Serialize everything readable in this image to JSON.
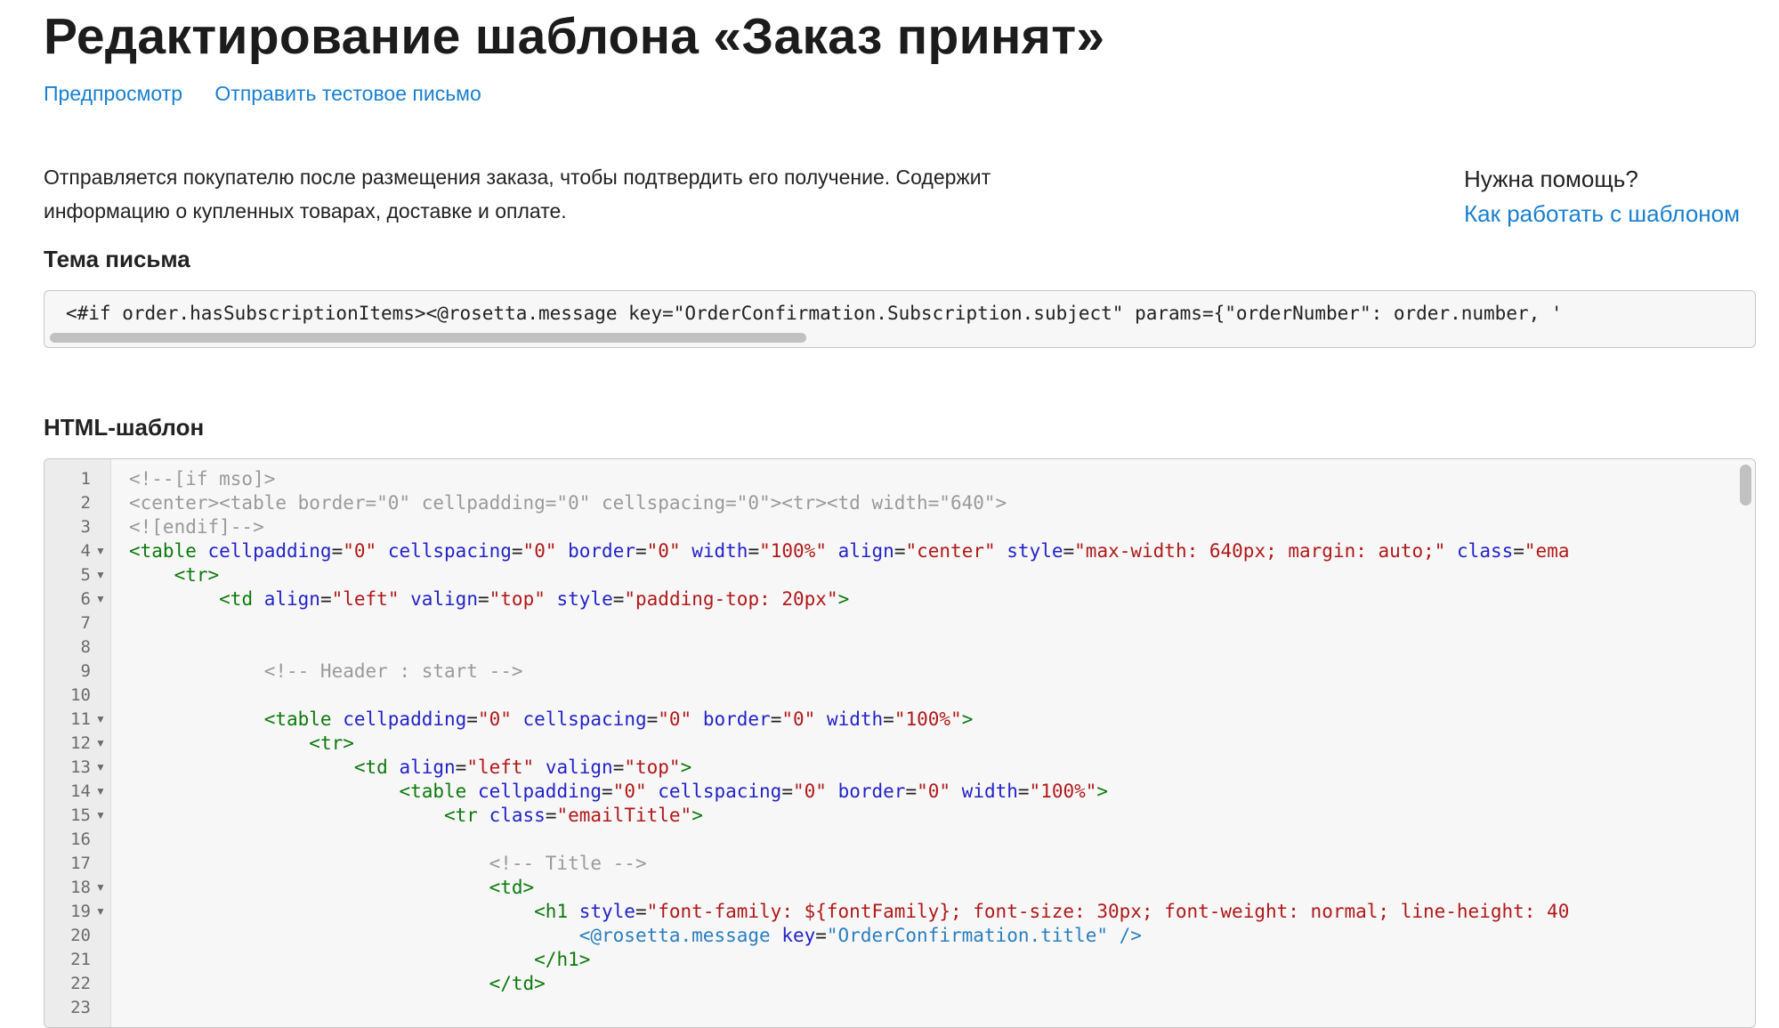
{
  "page": {
    "title": "Редактирование шаблона «Заказ принят»",
    "actions": [
      {
        "label": "Предпросмотр"
      },
      {
        "label": "Отправить тестовое письмо"
      }
    ],
    "description": "Отправляется покупателю после размещения заказа, чтобы подтвердить его получение. Содержит информацию о купленных товарах, доставке и оплате."
  },
  "help": {
    "question": "Нужна помощь?",
    "link": "Как работать с шаблоном"
  },
  "subject": {
    "label": "Тема письма",
    "value": "<#if order.hasSubscriptionItems><@rosetta.message key=\"OrderConfirmation.Subscription.subject\" params={\"orderNumber\": order.number, '"
  },
  "html_template": {
    "label": "HTML-шаблон",
    "lines": [
      {
        "num": "1",
        "fold": false,
        "indent": 0,
        "tokens": [
          {
            "t": "com",
            "v": "<!--[if mso]>"
          }
        ]
      },
      {
        "num": "2",
        "fold": false,
        "indent": 0,
        "tokens": [
          {
            "t": "com",
            "v": "<center><table border=\"0\" cellpadding=\"0\" cellspacing=\"0\"><tr><td width=\"640\">"
          }
        ]
      },
      {
        "num": "3",
        "fold": false,
        "indent": 0,
        "tokens": [
          {
            "t": "com",
            "v": "<![endif]-->"
          }
        ]
      },
      {
        "num": "4",
        "fold": true,
        "indent": 0,
        "tokens": [
          {
            "t": "tag",
            "v": "<table"
          },
          {
            "t": "attr",
            "v": " cellpadding"
          },
          {
            "t": "txt",
            "v": "="
          },
          {
            "t": "val",
            "v": "\"0\""
          },
          {
            "t": "attr",
            "v": " cellspacing"
          },
          {
            "t": "txt",
            "v": "="
          },
          {
            "t": "val",
            "v": "\"0\""
          },
          {
            "t": "attr",
            "v": " border"
          },
          {
            "t": "txt",
            "v": "="
          },
          {
            "t": "val",
            "v": "\"0\""
          },
          {
            "t": "attr",
            "v": " width"
          },
          {
            "t": "txt",
            "v": "="
          },
          {
            "t": "val",
            "v": "\"100%\""
          },
          {
            "t": "attr",
            "v": " align"
          },
          {
            "t": "txt",
            "v": "="
          },
          {
            "t": "val",
            "v": "\"center\""
          },
          {
            "t": "attr",
            "v": " style"
          },
          {
            "t": "txt",
            "v": "="
          },
          {
            "t": "val",
            "v": "\"max-width: 640px; margin: auto;\""
          },
          {
            "t": "attr",
            "v": " class"
          },
          {
            "t": "txt",
            "v": "="
          },
          {
            "t": "val",
            "v": "\"ema"
          }
        ]
      },
      {
        "num": "5",
        "fold": true,
        "indent": 4,
        "tokens": [
          {
            "t": "tag",
            "v": "<tr>"
          }
        ]
      },
      {
        "num": "6",
        "fold": true,
        "indent": 8,
        "tokens": [
          {
            "t": "tag",
            "v": "<td"
          },
          {
            "t": "attr",
            "v": " align"
          },
          {
            "t": "txt",
            "v": "="
          },
          {
            "t": "val",
            "v": "\"left\""
          },
          {
            "t": "attr",
            "v": " valign"
          },
          {
            "t": "txt",
            "v": "="
          },
          {
            "t": "val",
            "v": "\"top\""
          },
          {
            "t": "attr",
            "v": " style"
          },
          {
            "t": "txt",
            "v": "="
          },
          {
            "t": "val",
            "v": "\"padding-top: 20px\""
          },
          {
            "t": "tag",
            "v": ">"
          }
        ]
      },
      {
        "num": "7",
        "fold": false,
        "indent": 0,
        "tokens": []
      },
      {
        "num": "8",
        "fold": false,
        "indent": 0,
        "tokens": []
      },
      {
        "num": "9",
        "fold": false,
        "indent": 12,
        "tokens": [
          {
            "t": "com",
            "v": "<!-- Header : start -->"
          }
        ]
      },
      {
        "num": "10",
        "fold": false,
        "indent": 0,
        "tokens": []
      },
      {
        "num": "11",
        "fold": true,
        "indent": 12,
        "tokens": [
          {
            "t": "tag",
            "v": "<table"
          },
          {
            "t": "attr",
            "v": " cellpadding"
          },
          {
            "t": "txt",
            "v": "="
          },
          {
            "t": "val",
            "v": "\"0\""
          },
          {
            "t": "attr",
            "v": " cellspacing"
          },
          {
            "t": "txt",
            "v": "="
          },
          {
            "t": "val",
            "v": "\"0\""
          },
          {
            "t": "attr",
            "v": " border"
          },
          {
            "t": "txt",
            "v": "="
          },
          {
            "t": "val",
            "v": "\"0\""
          },
          {
            "t": "attr",
            "v": " width"
          },
          {
            "t": "txt",
            "v": "="
          },
          {
            "t": "val",
            "v": "\"100%\""
          },
          {
            "t": "tag",
            "v": ">"
          }
        ]
      },
      {
        "num": "12",
        "fold": true,
        "indent": 16,
        "tokens": [
          {
            "t": "tag",
            "v": "<tr>"
          }
        ]
      },
      {
        "num": "13",
        "fold": true,
        "indent": 20,
        "tokens": [
          {
            "t": "tag",
            "v": "<td"
          },
          {
            "t": "attr",
            "v": " align"
          },
          {
            "t": "txt",
            "v": "="
          },
          {
            "t": "val",
            "v": "\"left\""
          },
          {
            "t": "attr",
            "v": " valign"
          },
          {
            "t": "txt",
            "v": "="
          },
          {
            "t": "val",
            "v": "\"top\""
          },
          {
            "t": "tag",
            "v": ">"
          }
        ]
      },
      {
        "num": "14",
        "fold": true,
        "indent": 24,
        "tokens": [
          {
            "t": "tag",
            "v": "<table"
          },
          {
            "t": "attr",
            "v": " cellpadding"
          },
          {
            "t": "txt",
            "v": "="
          },
          {
            "t": "val",
            "v": "\"0\""
          },
          {
            "t": "attr",
            "v": " cellspacing"
          },
          {
            "t": "txt",
            "v": "="
          },
          {
            "t": "val",
            "v": "\"0\""
          },
          {
            "t": "attr",
            "v": " border"
          },
          {
            "t": "txt",
            "v": "="
          },
          {
            "t": "val",
            "v": "\"0\""
          },
          {
            "t": "attr",
            "v": " width"
          },
          {
            "t": "txt",
            "v": "="
          },
          {
            "t": "val",
            "v": "\"100%\""
          },
          {
            "t": "tag",
            "v": ">"
          }
        ]
      },
      {
        "num": "15",
        "fold": true,
        "indent": 28,
        "tokens": [
          {
            "t": "tag",
            "v": "<tr"
          },
          {
            "t": "attr",
            "v": " class"
          },
          {
            "t": "txt",
            "v": "="
          },
          {
            "t": "val",
            "v": "\"emailTitle\""
          },
          {
            "t": "tag",
            "v": ">"
          }
        ]
      },
      {
        "num": "16",
        "fold": false,
        "indent": 0,
        "tokens": []
      },
      {
        "num": "17",
        "fold": false,
        "indent": 32,
        "tokens": [
          {
            "t": "com",
            "v": "<!-- Title -->"
          }
        ]
      },
      {
        "num": "18",
        "fold": true,
        "indent": 32,
        "tokens": [
          {
            "t": "tag",
            "v": "<td>"
          }
        ]
      },
      {
        "num": "19",
        "fold": true,
        "indent": 36,
        "tokens": [
          {
            "t": "tag",
            "v": "<h1"
          },
          {
            "t": "attr",
            "v": " style"
          },
          {
            "t": "txt",
            "v": "="
          },
          {
            "t": "val",
            "v": "\"font-family: ${fontFamily}; font-size: 30px; font-weight: normal; line-height: 40"
          }
        ]
      },
      {
        "num": "20",
        "fold": false,
        "indent": 40,
        "tokens": [
          {
            "t": "ftl",
            "v": "<@rosetta.message"
          },
          {
            "t": "attr",
            "v": " key"
          },
          {
            "t": "txt",
            "v": "="
          },
          {
            "t": "ftl",
            "v": "\"OrderConfirmation.title\""
          },
          {
            "t": "ftl",
            "v": " />"
          }
        ]
      },
      {
        "num": "21",
        "fold": false,
        "indent": 36,
        "tokens": [
          {
            "t": "tag",
            "v": "</h1>"
          }
        ]
      },
      {
        "num": "22",
        "fold": false,
        "indent": 32,
        "tokens": [
          {
            "t": "tag",
            "v": "</td>"
          }
        ]
      },
      {
        "num": "23",
        "fold": false,
        "indent": 0,
        "tokens": []
      }
    ]
  },
  "colors": {
    "link": "#1a7fd0",
    "tag": "#0d7a0d",
    "attr": "#2323c8",
    "value": "#b01919",
    "comment": "#9a9a9a",
    "ftl": "#2a7fbf"
  }
}
